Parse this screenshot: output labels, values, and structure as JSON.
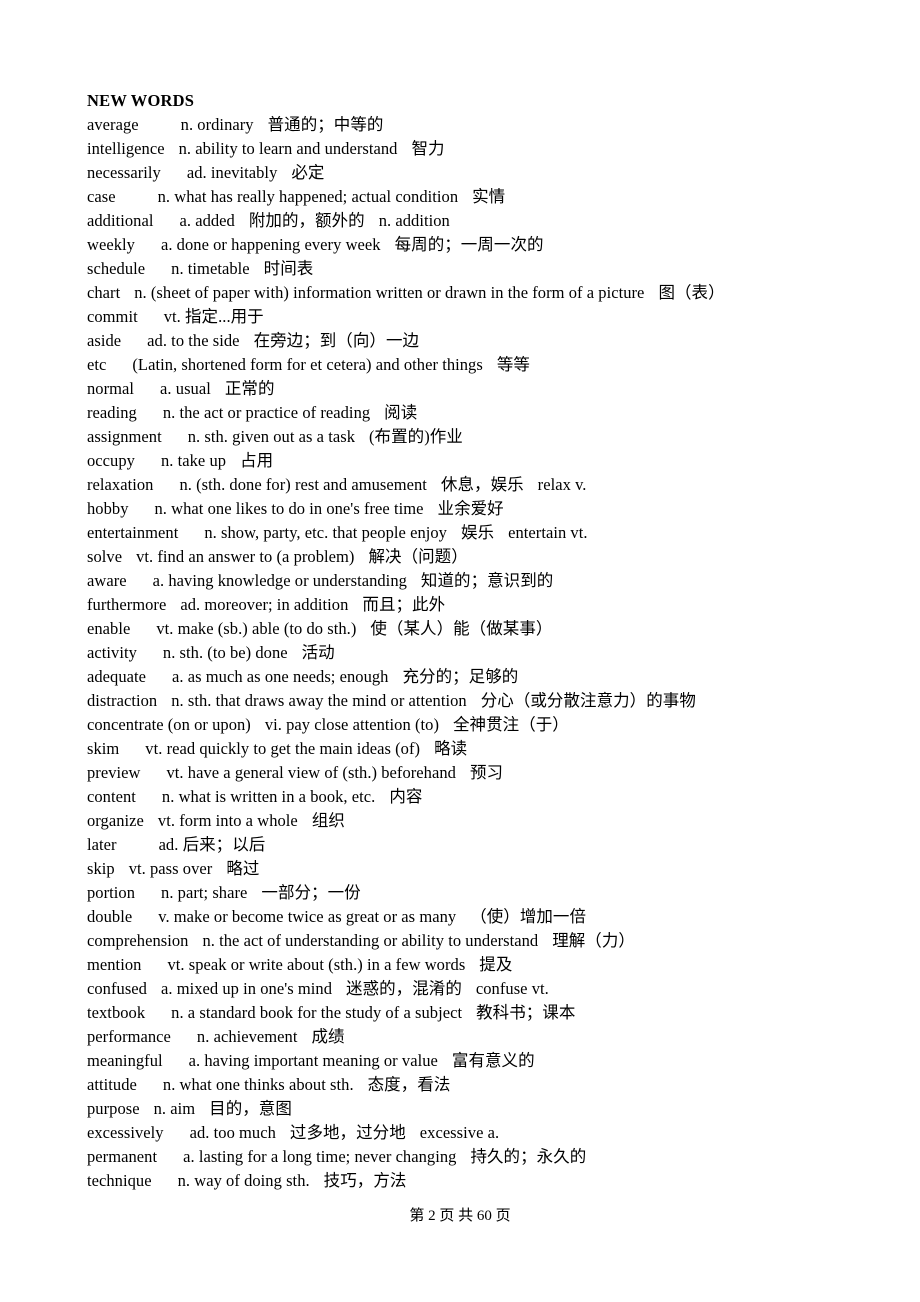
{
  "document": {
    "heading": "NEW WORDS",
    "footer": "第 2 页 共 60 页",
    "page_number": 2,
    "total_pages": 60
  },
  "entries": [
    {
      "word": "average",
      "gap": "xl",
      "definition": "n. ordinary",
      "chinese": "普通的；中等的",
      "extra": ""
    },
    {
      "word": "intelligence",
      "gap": "m",
      "definition": "n. ability to learn and understand",
      "chinese": "智力",
      "extra": ""
    },
    {
      "word": "necessarily",
      "gap": "l",
      "definition": "ad. inevitably",
      "chinese": "必定",
      "extra": ""
    },
    {
      "word": "case",
      "gap": "xl",
      "definition": "n. what has really happened; actual condition",
      "chinese": "实情",
      "extra": ""
    },
    {
      "word": "additional",
      "gap": "l",
      "definition": "a. added",
      "chinese": "附加的，额外的",
      "extra": "n. addition"
    },
    {
      "word": "weekly",
      "gap": "l",
      "definition": "a. done or happening every week",
      "chinese": "每周的；一周一次的",
      "extra": ""
    },
    {
      "word": "schedule",
      "gap": "l",
      "definition": "n. timetable",
      "chinese": "时间表",
      "extra": ""
    },
    {
      "word": "chart",
      "gap": "m",
      "definition": "n. (sheet of paper with) information written or drawn in the form of a picture",
      "chinese": "图（表）",
      "extra": ""
    },
    {
      "word": "commit",
      "gap": "l",
      "definition": "vt. 指定...用于",
      "chinese": "",
      "extra": ""
    },
    {
      "word": "aside",
      "gap": "l",
      "definition": "ad. to the side",
      "chinese": "在旁边；到（向）一边",
      "extra": ""
    },
    {
      "word": "etc",
      "gap": "l",
      "definition": "(Latin, shortened form for et cetera) and other things",
      "chinese": "等等",
      "extra": ""
    },
    {
      "word": "normal",
      "gap": "l",
      "definition": "a. usual",
      "chinese": "正常的",
      "extra": ""
    },
    {
      "word": "reading",
      "gap": "l",
      "definition": "n. the act or practice of reading",
      "chinese": "阅读",
      "extra": ""
    },
    {
      "word": "assignment",
      "gap": "l",
      "definition": "n. sth. given out as a task",
      "chinese": "(布置的)作业",
      "extra": ""
    },
    {
      "word": "occupy",
      "gap": "l",
      "definition": "n. take up",
      "chinese": "占用",
      "extra": ""
    },
    {
      "word": "relaxation",
      "gap": "l",
      "definition": "n. (sth. done for) rest and amusement",
      "chinese": "休息，娱乐",
      "extra": "relax    v."
    },
    {
      "word": "hobby",
      "gap": "l",
      "definition": "n. what one likes to do in one's free time",
      "chinese": "业余爱好",
      "extra": ""
    },
    {
      "word": "entertainment",
      "gap": "l",
      "definition": "n. show, party, etc. that people enjoy",
      "chinese": "娱乐",
      "extra": "entertain    vt."
    },
    {
      "word": "solve",
      "gap": "m",
      "definition": "vt. find an answer to (a problem)",
      "chinese": "解决（问题）",
      "extra": ""
    },
    {
      "word": "aware",
      "gap": "l",
      "definition": "a. having knowledge or understanding",
      "chinese": "知道的；意识到的",
      "extra": ""
    },
    {
      "word": "furthermore",
      "gap": "m",
      "definition": "ad. moreover; in addition",
      "chinese": "而且；此外",
      "extra": ""
    },
    {
      "word": "enable",
      "gap": "l",
      "definition": "vt. make (sb.) able (to do sth.)",
      "chinese": "使（某人）能（做某事）",
      "extra": ""
    },
    {
      "word": "activity",
      "gap": "l",
      "definition": "n. sth. (to be) done",
      "chinese": "活动",
      "extra": ""
    },
    {
      "word": "adequate",
      "gap": "l",
      "definition": "a. as much as one needs; enough",
      "chinese": "充分的；足够的",
      "extra": ""
    },
    {
      "word": "distraction",
      "gap": "m",
      "definition": "n. sth. that draws away the mind or attention",
      "chinese": "分心（或分散注意力）的事物",
      "extra": ""
    },
    {
      "word": "concentrate (on or upon)",
      "gap": "m",
      "definition": "vi. pay close attention (to)",
      "chinese": "全神贯注（于）",
      "extra": ""
    },
    {
      "word": "skim",
      "gap": "l",
      "definition": "vt. read quickly to get the main ideas (of)",
      "chinese": "略读",
      "extra": ""
    },
    {
      "word": "preview",
      "gap": "l",
      "definition": "vt. have a general view of (sth.) beforehand",
      "chinese": "预习",
      "extra": ""
    },
    {
      "word": "content",
      "gap": "l",
      "definition": "n. what is written in a book, etc.",
      "chinese": "内容",
      "extra": ""
    },
    {
      "word": "organize",
      "gap": "m",
      "definition": "vt. form into a whole",
      "chinese": "组织",
      "extra": ""
    },
    {
      "word": "later",
      "gap": "xl",
      "definition": "ad. 后来；以后",
      "chinese": "",
      "extra": ""
    },
    {
      "word": "skip",
      "gap": "m",
      "definition": "vt. pass over",
      "chinese": "略过",
      "extra": ""
    },
    {
      "word": "portion",
      "gap": "l",
      "definition": "n. part; share",
      "chinese": "一部分；一份",
      "extra": ""
    },
    {
      "word": "double",
      "gap": "l",
      "definition": "v. make or become twice as great or as many",
      "chinese": "（使）增加一倍",
      "extra": ""
    },
    {
      "word": "comprehension",
      "gap": "m",
      "definition": "n. the act of understanding or ability to understand",
      "chinese": "理解（力）",
      "extra": ""
    },
    {
      "word": "mention",
      "gap": "l",
      "definition": "vt. speak or write about (sth.) in a few words",
      "chinese": "提及",
      "extra": ""
    },
    {
      "word": "confused",
      "gap": "m",
      "definition": "a. mixed up in one's mind",
      "chinese": "迷惑的，混淆的",
      "extra": "confuse    vt."
    },
    {
      "word": "textbook",
      "gap": "l",
      "definition": "n. a standard book for the study of a subject",
      "chinese": "教科书；课本",
      "extra": ""
    },
    {
      "word": "performance",
      "gap": "l",
      "definition": "n. achievement",
      "chinese": "成绩",
      "extra": ""
    },
    {
      "word": "meaningful",
      "gap": "l",
      "definition": "a. having important meaning or value",
      "chinese": "富有意义的",
      "extra": ""
    },
    {
      "word": "attitude",
      "gap": "l",
      "definition": "n. what one thinks about sth.",
      "chinese": "态度，看法",
      "extra": ""
    },
    {
      "word": "purpose",
      "gap": "m",
      "definition": "n. aim",
      "chinese": "目的，意图",
      "extra": ""
    },
    {
      "word": "excessively",
      "gap": "l",
      "definition": "ad. too much",
      "chinese": "过多地，过分地",
      "extra": "excessive    a."
    },
    {
      "word": "permanent",
      "gap": "l",
      "definition": "a. lasting for a long time; never changing",
      "chinese": "持久的；永久的",
      "extra": ""
    },
    {
      "word": "technique",
      "gap": "l",
      "definition": "n. way of doing sth.",
      "chinese": "技巧，方法",
      "extra": ""
    }
  ]
}
